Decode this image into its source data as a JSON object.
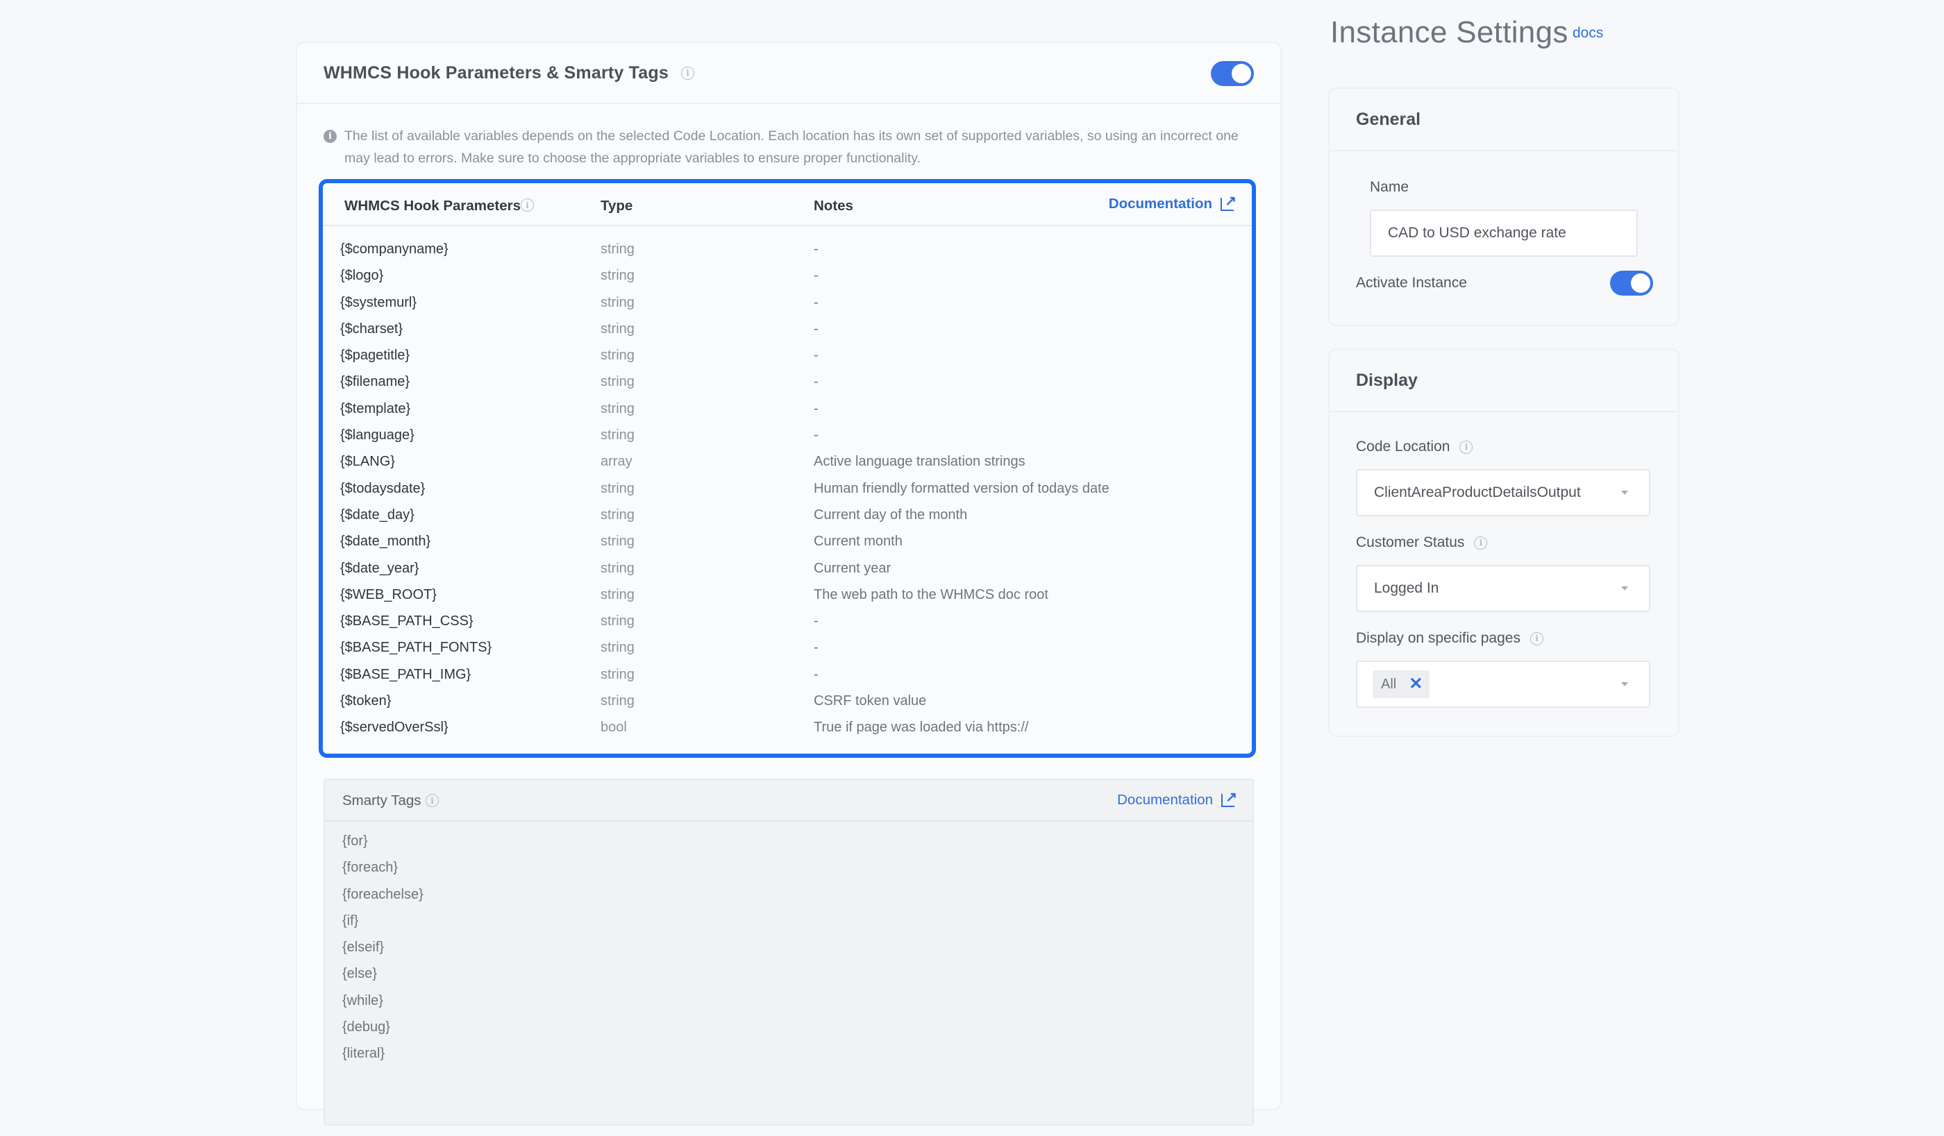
{
  "panel": {
    "title": "WHMCS Hook Parameters & Smarty Tags",
    "enabled": true,
    "notice": "The list of available variables depends on the selected Code Location. Each location has its own set of supported variables, so using an incorrect one may lead to errors. Make sure to choose the appropriate variables to ensure proper functionality."
  },
  "hook_params": {
    "headers": {
      "param": "WHMCS Hook Parameters",
      "type": "Type",
      "notes": "Notes"
    },
    "doc_link": "Documentation",
    "rows": [
      {
        "param": "{$companyname}",
        "type": "string",
        "notes": "-"
      },
      {
        "param": "{$logo}",
        "type": "string",
        "notes": "-"
      },
      {
        "param": "{$systemurl}",
        "type": "string",
        "notes": "-"
      },
      {
        "param": "{$charset}",
        "type": "string",
        "notes": "-"
      },
      {
        "param": "{$pagetitle}",
        "type": "string",
        "notes": "-"
      },
      {
        "param": "{$filename}",
        "type": "string",
        "notes": "-"
      },
      {
        "param": "{$template}",
        "type": "string",
        "notes": "-"
      },
      {
        "param": "{$language}",
        "type": "string",
        "notes": "-"
      },
      {
        "param": "{$LANG}",
        "type": "array",
        "notes": "Active language translation strings"
      },
      {
        "param": "{$todaysdate}",
        "type": "string",
        "notes": "Human friendly formatted version of todays date"
      },
      {
        "param": "{$date_day}",
        "type": "string",
        "notes": "Current day of the month"
      },
      {
        "param": "{$date_month}",
        "type": "string",
        "notes": "Current month"
      },
      {
        "param": "{$date_year}",
        "type": "string",
        "notes": "Current year"
      },
      {
        "param": "{$WEB_ROOT}",
        "type": "string",
        "notes": "The web path to the WHMCS doc root"
      },
      {
        "param": "{$BASE_PATH_CSS}",
        "type": "string",
        "notes": "-"
      },
      {
        "param": "{$BASE_PATH_FONTS}",
        "type": "string",
        "notes": "-"
      },
      {
        "param": "{$BASE_PATH_IMG}",
        "type": "string",
        "notes": "-"
      },
      {
        "param": "{$token}",
        "type": "string",
        "notes": "CSRF token value"
      },
      {
        "param": "{$servedOverSsl}",
        "type": "bool",
        "notes": "True if page was loaded via https://"
      }
    ]
  },
  "smarty": {
    "header": "Smarty Tags",
    "doc_link": "Documentation",
    "tags": [
      "{for}",
      "{foreach}",
      "{foreachelse}",
      "{if}",
      "{elseif}",
      "{else}",
      "{while}",
      "{debug}",
      "{literal}"
    ]
  },
  "sidebar": {
    "title": "Instance Settings",
    "docs_link": "docs",
    "general": {
      "heading": "General",
      "name_label": "Name",
      "name_value": "CAD to USD exchange rate",
      "activate_label": "Activate Instance",
      "activate_on": true
    },
    "display": {
      "heading": "Display",
      "code_location_label": "Code Location",
      "code_location_value": "ClientAreaProductDetailsOutput",
      "customer_status_label": "Customer Status",
      "customer_status_value": "Logged In",
      "pages_label": "Display on specific pages",
      "pages_chip": "All"
    }
  },
  "colors": {
    "accent": "#3a74e6",
    "highlight_border": "#1b6cf2",
    "link": "#2f6fd6"
  },
  "icons": {
    "info": "info-circle-icon",
    "external": "external-link-icon",
    "remove": "close-icon",
    "caret": "caret-down-icon"
  }
}
